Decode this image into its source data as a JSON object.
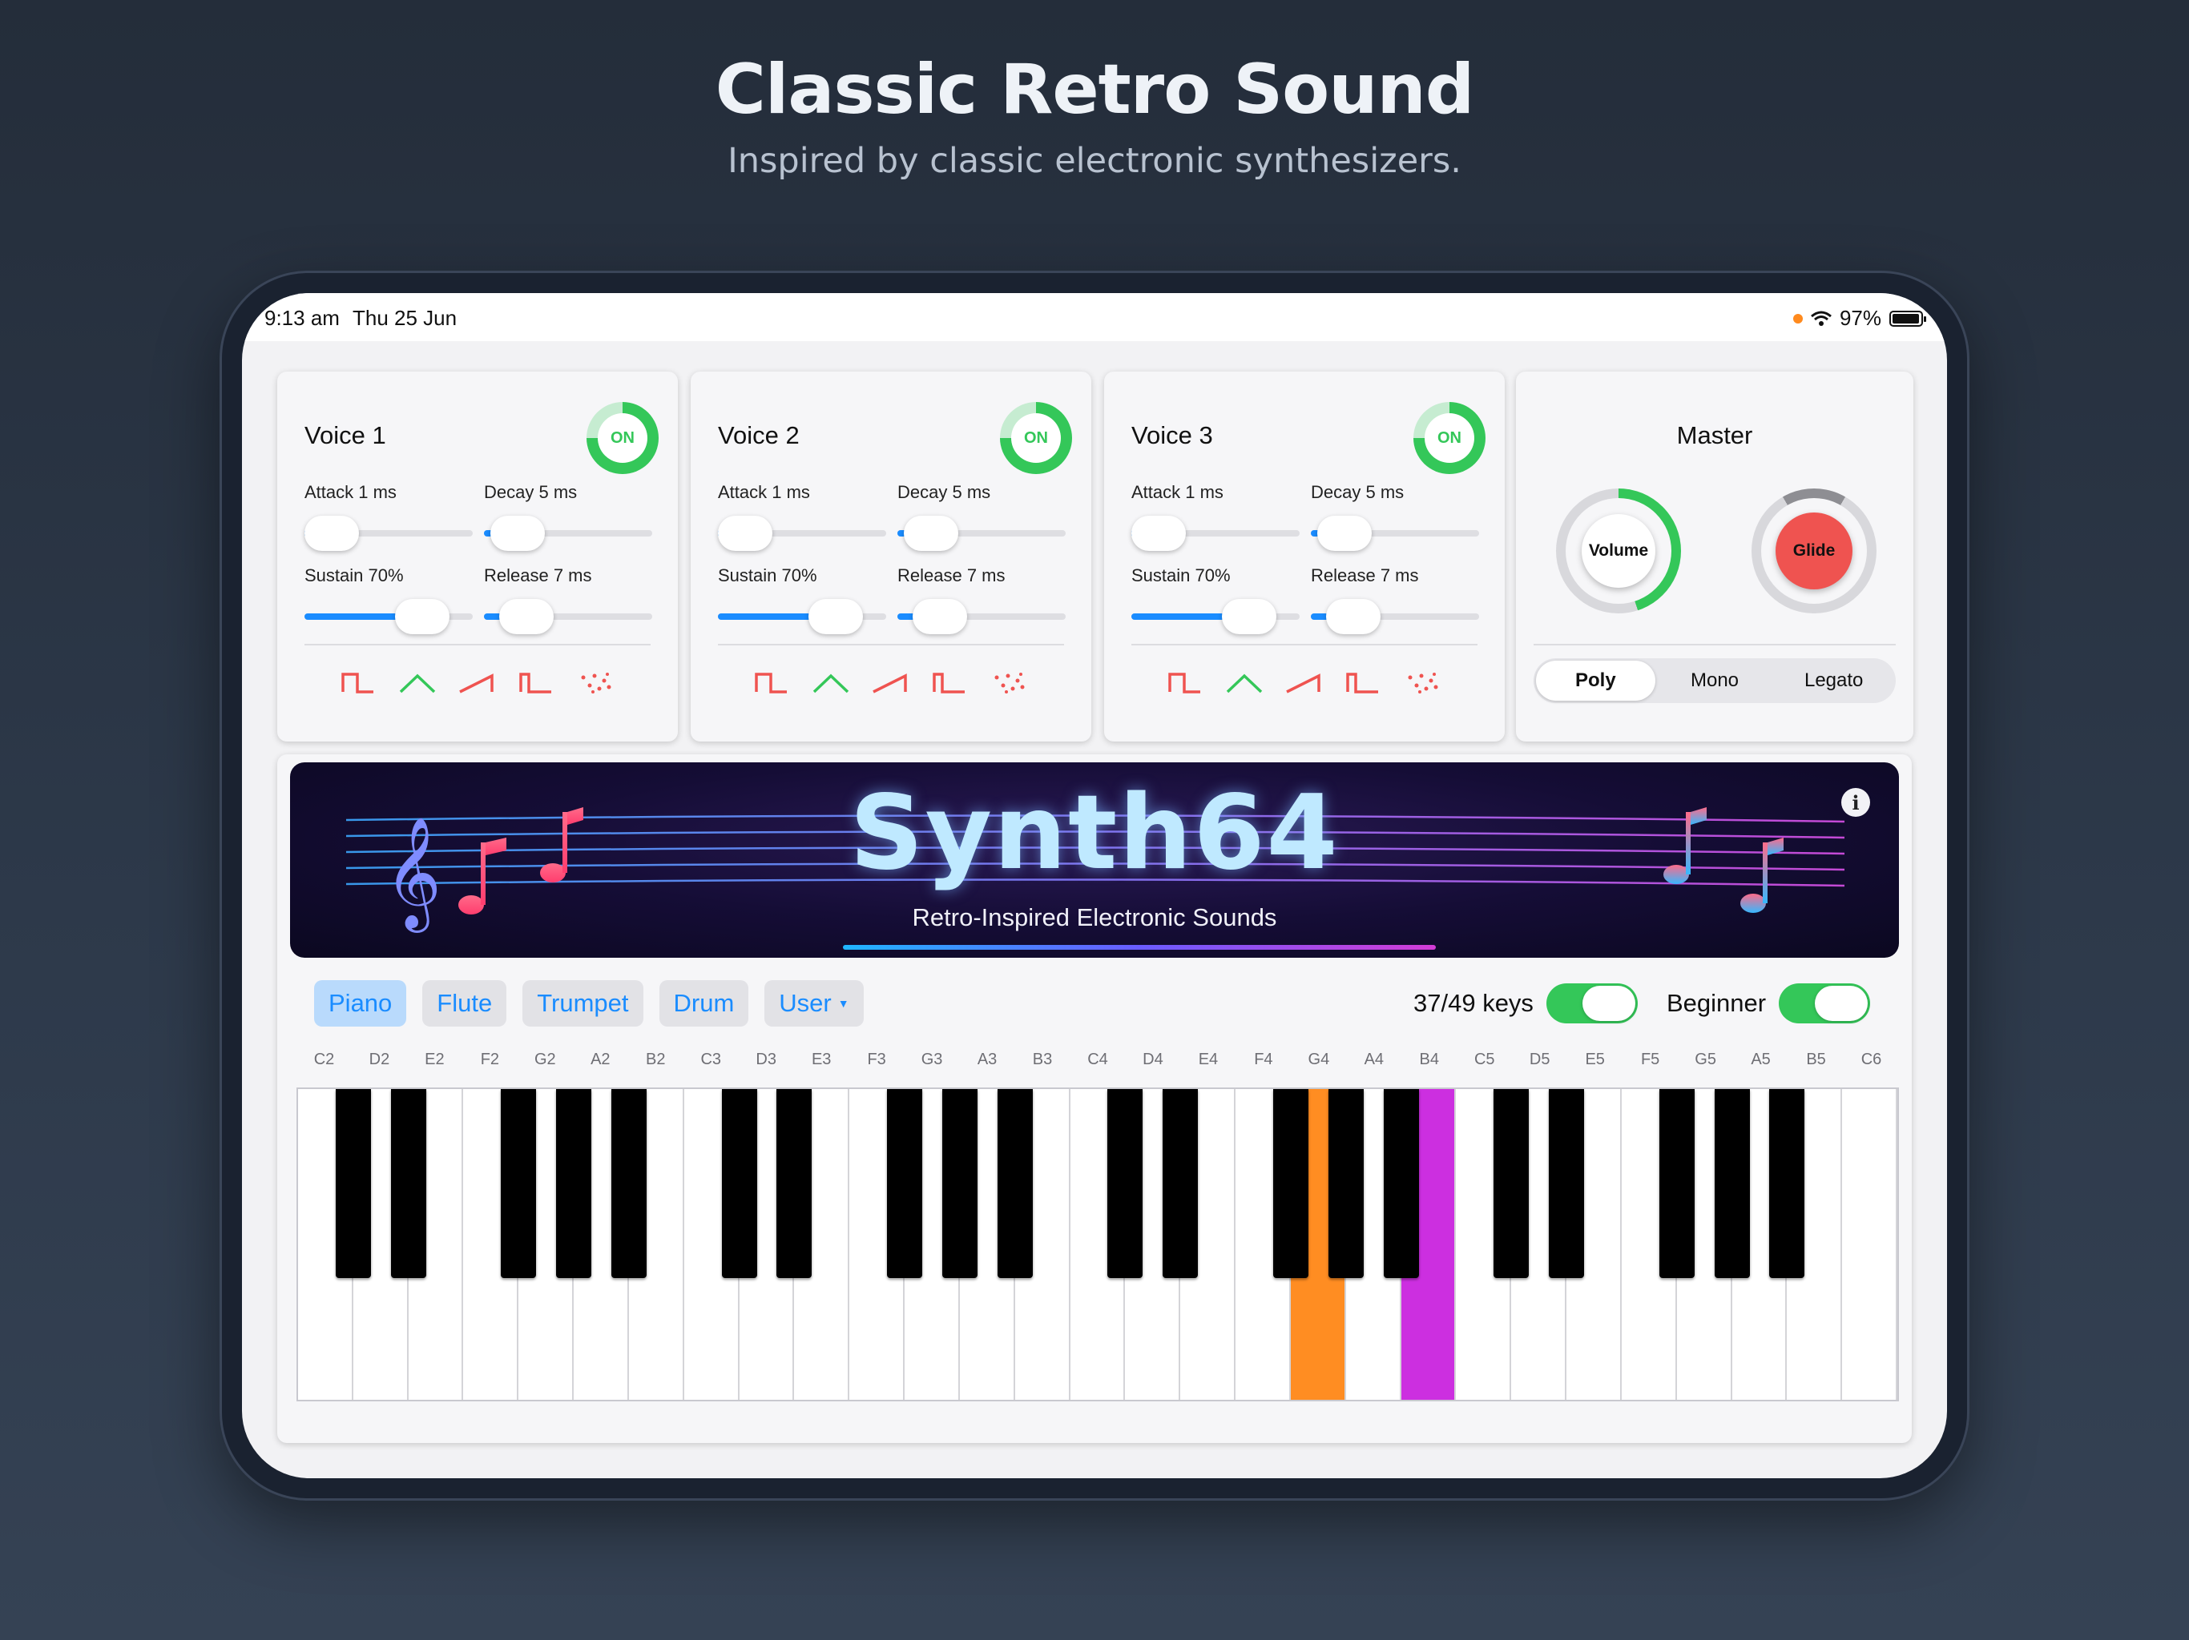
{
  "promo": {
    "headline": "Classic Retro Sound",
    "subheadline": "Inspired by classic electronic synthesizers."
  },
  "statusbar": {
    "time": "9:13 am",
    "date": "Thu 25 Jun",
    "battery": "97%",
    "battery_level": 0.97
  },
  "voices": [
    {
      "title": "Voice 1",
      "toggle": "ON",
      "attack": "Attack 1 ms",
      "decay": "Decay 5 ms",
      "sustain": "Sustain 70%",
      "release": "Release 7 ms",
      "attack_level": 0.02,
      "decay_level": 0.2,
      "sustain_level": 0.7,
      "release_level": 0.25
    },
    {
      "title": "Voice 2",
      "toggle": "ON",
      "attack": "Attack 1 ms",
      "decay": "Decay 5 ms",
      "sustain": "Sustain 70%",
      "release": "Release 7 ms",
      "attack_level": 0.02,
      "decay_level": 0.2,
      "sustain_level": 0.7,
      "release_level": 0.25
    },
    {
      "title": "Voice 3",
      "toggle": "ON",
      "attack": "Attack 1 ms",
      "decay": "Decay 5 ms",
      "sustain": "Sustain 70%",
      "release": "Release 7 ms",
      "attack_level": 0.02,
      "decay_level": 0.2,
      "sustain_level": 0.7,
      "release_level": 0.25
    }
  ],
  "waveforms": [
    "square-wave-icon",
    "triangle-wave-icon",
    "sawtooth-wave-icon",
    "pulse-wave-icon",
    "noise-wave-icon"
  ],
  "master": {
    "title": "Master",
    "volume_label": "Volume",
    "volume_level": 0.45,
    "glide_label": "Glide",
    "modes": [
      "Poly",
      "Mono",
      "Legato"
    ],
    "active_mode": "Poly"
  },
  "banner": {
    "title": "Synth64",
    "subtitle": "Retro-Inspired Electronic Sounds"
  },
  "instruments": {
    "items": [
      "Piano",
      "Flute",
      "Trumpet",
      "Drum",
      "User"
    ],
    "active": "Piano"
  },
  "keys_toggle": {
    "label": "37/49 keys",
    "on": true
  },
  "beginner_toggle": {
    "label": "Beginner",
    "on": true
  },
  "note_labels": [
    "C2",
    "D2",
    "E2",
    "F2",
    "G2",
    "A2",
    "B2",
    "C3",
    "D3",
    "E3",
    "F3",
    "G3",
    "A3",
    "B3",
    "C4",
    "D4",
    "E4",
    "F4",
    "G4",
    "A4",
    "B4",
    "C5",
    "D5",
    "E5",
    "F5",
    "G5",
    "A5",
    "B5",
    "C6"
  ],
  "highlighted_keys": {
    "G4": "orange",
    "B4": "purple"
  },
  "colors": {
    "accent": "#1a8cff",
    "on_green": "#34c759",
    "glide_red": "#ef5350",
    "highlight_orange": "#ff8d22",
    "highlight_purple": "#cc2fe0"
  }
}
